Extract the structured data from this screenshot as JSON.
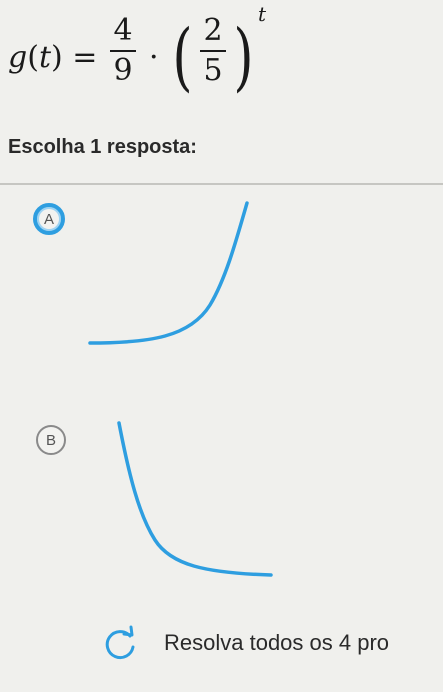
{
  "formula": {
    "func": "g",
    "var": "t",
    "equals": "=",
    "frac1_num": "4",
    "frac1_den": "9",
    "dot": "·",
    "frac2_num": "2",
    "frac2_den": "5",
    "exponent": "t"
  },
  "prompt": "Escolha 1 resposta:",
  "options": [
    {
      "letter": "A",
      "selected": true
    },
    {
      "letter": "B",
      "selected": false
    }
  ],
  "footer": {
    "label": "Resolva todos os 4 pro",
    "icon": "refresh-icon"
  },
  "colors": {
    "curve": "#2e9ee0",
    "selected_ring": "#2e9ee0"
  }
}
